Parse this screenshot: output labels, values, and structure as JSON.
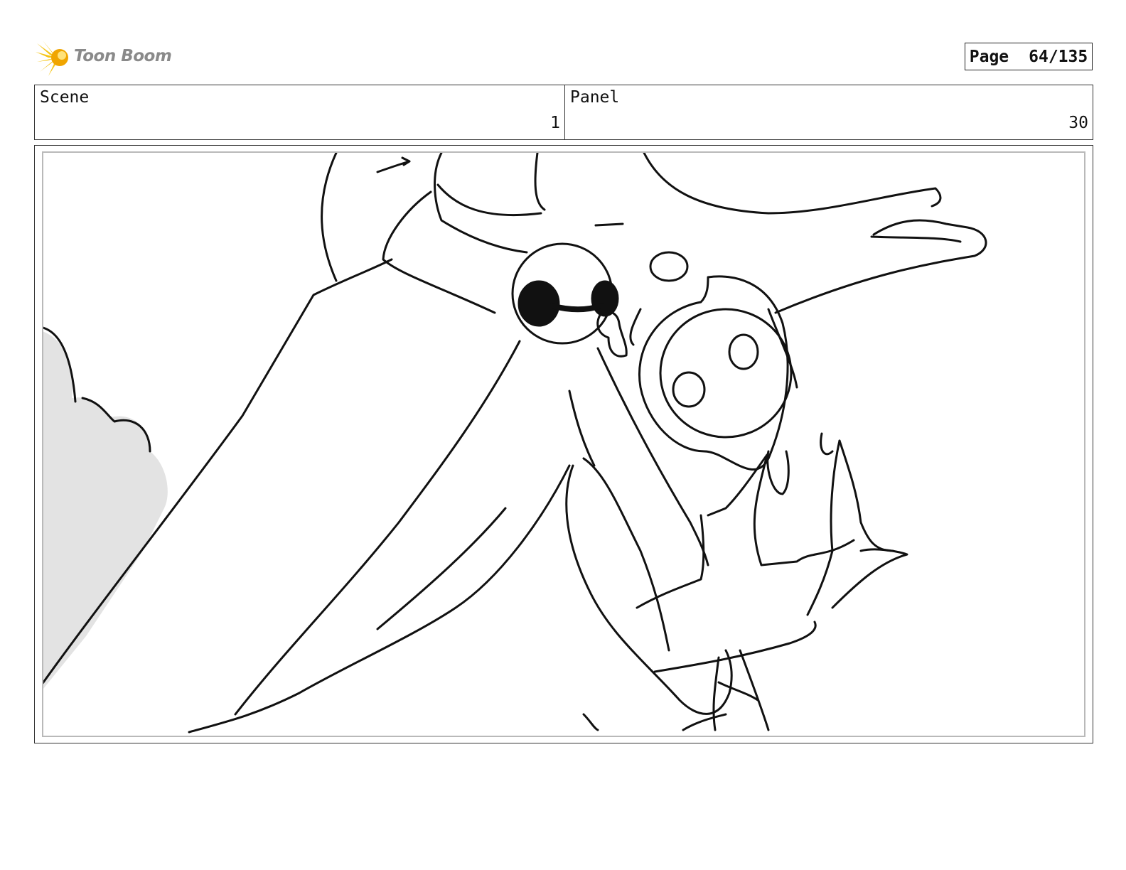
{
  "header": {
    "logo_text": "Toon Boom",
    "page_label": "Page",
    "page_number": "64/135"
  },
  "info": {
    "scene_label": "Scene",
    "scene_value": "1",
    "panel_label": "Panel",
    "panel_value": "30"
  },
  "colors": {
    "logo_star": "#f5c518",
    "logo_text": "#8a8a8a",
    "frame_border": "#333333",
    "inner_border": "#b9b9b9",
    "smoke_fill": "#e3e3e3"
  },
  "drawing": {
    "subject": "storyboard-sketch"
  }
}
